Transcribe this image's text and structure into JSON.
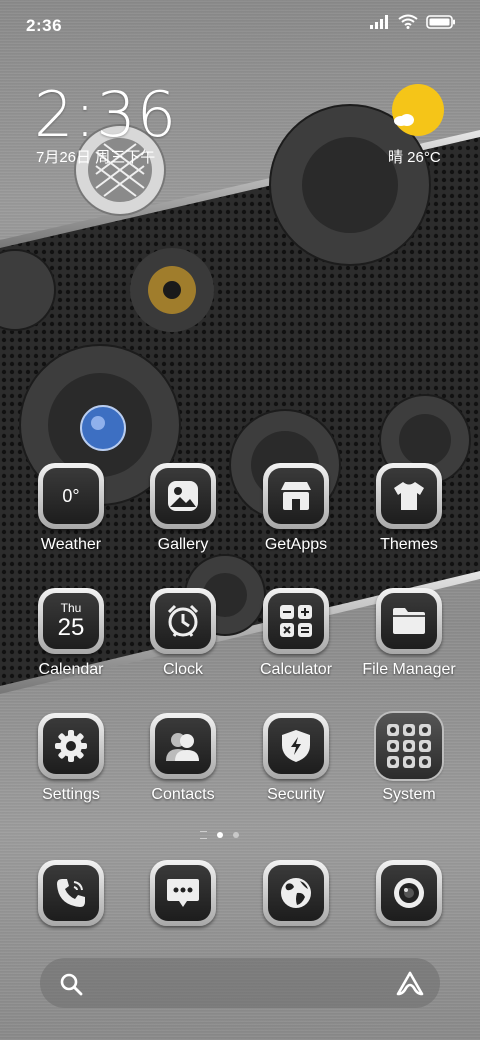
{
  "status": {
    "time": "2:36",
    "icons": [
      "signal-icon",
      "wifi-icon",
      "battery-icon"
    ]
  },
  "lock_widget": {
    "time": "2:36",
    "date": "7月26日 周三下午",
    "weather": "晴 26°C",
    "weather_icon": "sun-cloud-icon"
  },
  "apps": [
    {
      "label": "Weather",
      "icon": "weather-icon",
      "tile_text": "0°"
    },
    {
      "label": "Gallery",
      "icon": "gallery-icon"
    },
    {
      "label": "GetApps",
      "icon": "store-icon"
    },
    {
      "label": "Themes",
      "icon": "tshirt-icon"
    },
    {
      "label": "Calendar",
      "icon": "calendar-icon",
      "tile_day": "Thu",
      "tile_date": "25"
    },
    {
      "label": "Clock",
      "icon": "alarm-clock-icon"
    },
    {
      "label": "Calculator",
      "icon": "calculator-icon"
    },
    {
      "label": "File Manager",
      "icon": "folder-icon"
    },
    {
      "label": "Settings",
      "icon": "gear-icon"
    },
    {
      "label": "Contacts",
      "icon": "contacts-icon"
    },
    {
      "label": "Security",
      "icon": "shield-icon"
    },
    {
      "label": "System",
      "icon": "app-folder-icon"
    }
  ],
  "dock": [
    {
      "name": "phone",
      "icon": "phone-icon"
    },
    {
      "name": "messages",
      "icon": "message-icon"
    },
    {
      "name": "browser",
      "icon": "globe-icon"
    },
    {
      "name": "camera",
      "icon": "camera-icon"
    }
  ],
  "page_indicator": {
    "pages": 2,
    "current": 1
  },
  "colors": {
    "sun": "#f5c518",
    "gear_gold": "#a07d2c",
    "gem_blue": "#3d6fc2"
  }
}
